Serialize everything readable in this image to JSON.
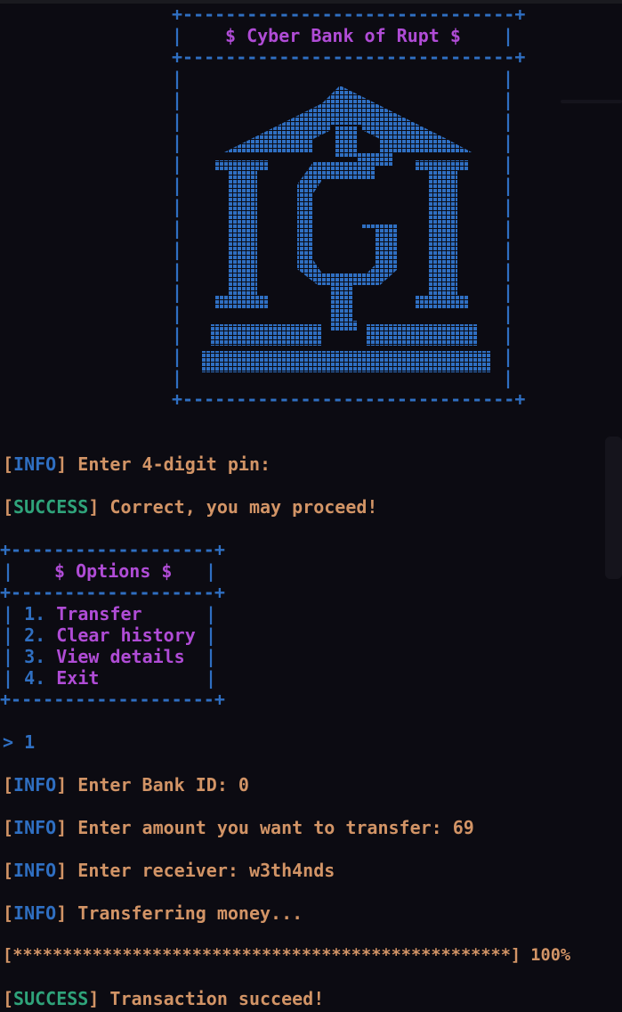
{
  "banner": {
    "title": "$ Cyber Bank of Rupt $"
  },
  "logo": {
    "icon": "bank-building-icon",
    "color": "#2f6fc2"
  },
  "colors": {
    "background": "#0c0b12",
    "text": "#d29466",
    "tag_info": "#2f6fc2",
    "tag_success": "#2fa37a",
    "menu_text": "#b04cd6",
    "border": "#2f6fc2"
  },
  "log": {
    "pin_tag": "INFO",
    "pin_text": " Enter 4-digit pin:",
    "pin_ok_tag": "SUCCESS",
    "pin_ok_text": " Correct, you may proceed!",
    "bank_id_tag": "INFO",
    "bank_id_text": " Enter Bank ID: 0",
    "amount_tag": "INFO",
    "amount_text": " Enter amount you want to transfer: 69",
    "receiver_tag": "INFO",
    "receiver_text": " Enter receiver: w3th4nds",
    "transferring_tag": "INFO",
    "transferring_text": " Transferring money...",
    "progress_bar": "[**************************************************]",
    "progress_percent": " 100%",
    "progress_value": 1.0,
    "done_tag": "SUCCESS",
    "done_text": " Transaction succeed!"
  },
  "menu": {
    "title": "$ Options $",
    "items": [
      {
        "num": "1.",
        "label": "Transfer"
      },
      {
        "num": "2.",
        "label": "Clear history"
      },
      {
        "num": "3.",
        "label": "View details"
      },
      {
        "num": "4.",
        "label": "Exit"
      }
    ]
  },
  "prompt": {
    "symbol": ">",
    "input": "1"
  }
}
